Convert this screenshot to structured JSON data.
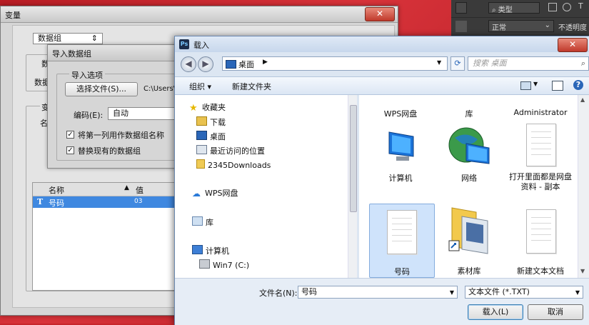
{
  "photoshop_panel": {
    "kind_label": "类型",
    "mode_label": "正常",
    "opacity_label": "不透明度",
    "text_tool": "T"
  },
  "variables_dialog": {
    "title": "变量",
    "dataset_select": "数据组",
    "dataset_label": "数",
    "dataset_label2": "数据",
    "variables_label": "变",
    "name_label": "名",
    "list_headers": [
      "名称",
      "值"
    ],
    "list_rows": [
      {
        "icon": "T",
        "name": "号码",
        "value": "03"
      }
    ]
  },
  "import_dialog": {
    "title": "导入数据组",
    "options_label": "导入选项",
    "select_file_button": "选择文件(S)...",
    "path": "C:\\Users\\",
    "encoding_label": "编码(E):",
    "encoding_value": "自动",
    "check_first_column": "将第一列用作数据组名称",
    "check_replace": "替换现有的数据组"
  },
  "load_dialog": {
    "title": "载入",
    "address": "桌面",
    "search_placeholder": "搜索 桌面",
    "toolbar": {
      "organize": "组织 ▾",
      "new_folder": "新建文件夹"
    },
    "tree": [
      {
        "label": "收藏夹",
        "icon": "star-icon"
      },
      {
        "label": "下载",
        "icon": "download-folder-icon"
      },
      {
        "label": "桌面",
        "icon": "desktop-icon"
      },
      {
        "label": "最近访问的位置",
        "icon": "recent-places-icon"
      },
      {
        "label": "2345Downloads",
        "icon": "folder-icon"
      },
      {
        "label": "WPS网盘",
        "icon": "cloud-icon"
      },
      {
        "label": "库",
        "icon": "library-icon"
      },
      {
        "label": "计算机",
        "icon": "computer-icon"
      },
      {
        "label": "Win7 (C:)",
        "icon": "drive-icon"
      }
    ],
    "files_top_labels": [
      "WPS网盘",
      "库",
      "Administrator"
    ],
    "files": [
      {
        "label": "计算机",
        "icon": "computer-icon"
      },
      {
        "label": "网络",
        "icon": "network-globe-icon"
      },
      {
        "label": "打开里面都是网盘资料 - 副本",
        "icon": "text-document-icon"
      },
      {
        "label": "号码",
        "icon": "text-document-icon"
      },
      {
        "label": "素材库",
        "icon": "folder-shortcut-icon"
      },
      {
        "label": "新建文本文档",
        "icon": "text-document-icon"
      }
    ],
    "filename_label": "文件名(N):",
    "filename_value": "号码",
    "filetype_value": "文本文件 (*.TXT)",
    "load_button": "载入(L)",
    "cancel_button": "取消"
  }
}
